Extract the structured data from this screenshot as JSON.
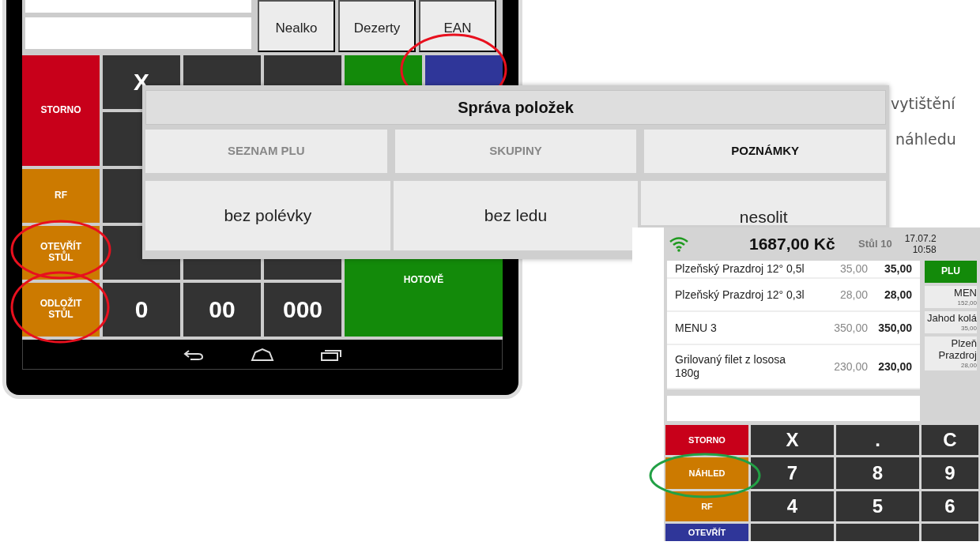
{
  "document_text": [
    "vytištění",
    "náhledu"
  ],
  "tablet": {
    "category_buttons": [
      "Nealko",
      "Dezerty",
      "EAN"
    ],
    "keys": [
      {
        "label": "STORNO",
        "color": "#c8001a"
      },
      {
        "label": "X",
        "color": "#333333"
      },
      {
        "color": "#333333"
      },
      {
        "color": "#333333"
      },
      {
        "color": "#138a0a"
      },
      {
        "color": "#2f3699"
      },
      {
        "color": "#333333"
      },
      {
        "label": "RF",
        "color": "#cc7a00"
      },
      {
        "color": "#333333"
      },
      {
        "label": "OTEVŘÍT STŮL",
        "color": "#cc7a00"
      },
      {
        "color": "#333333"
      },
      {
        "color": "#333333"
      },
      {
        "color": "#333333"
      },
      {
        "label": "HOTOVĚ",
        "color": "#138a0a"
      },
      {
        "label": "ODLOŽIT STŮL",
        "color": "#cc7a00"
      },
      {
        "label": "0",
        "color": "#333333"
      },
      {
        "label": "00",
        "color": "#333333"
      },
      {
        "label": "000",
        "color": "#333333"
      }
    ],
    "highlights": [
      {
        "color": "#e8101e"
      },
      {
        "color": "#e8101e"
      },
      {
        "color": "#e8101e"
      }
    ]
  },
  "dialog": {
    "title": "Správa položek",
    "tabs": [
      {
        "label": "SEZNAM PLU",
        "selected": false
      },
      {
        "label": "SKUPINY",
        "selected": false
      },
      {
        "label": "POZNÁMKY",
        "selected": true
      }
    ],
    "notes": [
      "bez polévky",
      "bez ledu",
      "nesolit"
    ]
  },
  "pos": {
    "total": "1687,00 Kč",
    "table": "Stůl 10",
    "date": "17.07.2",
    "time": "10:58",
    "items": [
      {
        "name": "Plzeňský Prazdroj 12° 0,5l",
        "price": "35,00",
        "total": "35,00"
      },
      {
        "name": "Plzeňský Prazdroj 12° 0,3l",
        "price": "28,00",
        "total": "28,00"
      },
      {
        "name": "MENU 3",
        "price": "350,00",
        "total": "350,00"
      },
      {
        "name": "Grilovaný filet z lososa 180g",
        "price": "230,00",
        "total": "230,00"
      }
    ],
    "side": [
      {
        "kind": "action",
        "label": "PLU"
      },
      {
        "kind": "product",
        "label": "MEN",
        "price": "152,00"
      },
      {
        "kind": "product",
        "label": "Jahod kolá",
        "price": "35,00"
      },
      {
        "kind": "product",
        "label": "Plzeň Prazdroj",
        "price": "28,00"
      }
    ],
    "keys": [
      {
        "label": "STORNO",
        "color": "#c8001a"
      },
      {
        "label": "X",
        "color": "#333333"
      },
      {
        "label": ".",
        "color": "#333333"
      },
      {
        "label": "C",
        "color": "#333333"
      },
      {
        "label": "NÁHLED",
        "color": "#cc7a00"
      },
      {
        "label": "7",
        "color": "#333333"
      },
      {
        "label": "8",
        "color": "#333333"
      },
      {
        "label": "9",
        "color": "#333333"
      },
      {
        "label": "RF",
        "color": "#cc7a00"
      },
      {
        "label": "4",
        "color": "#333333"
      },
      {
        "label": "5",
        "color": "#333333"
      },
      {
        "label": "6",
        "color": "#333333"
      },
      {
        "label": "OTEVŘÍT",
        "color": "#2f3699"
      },
      {
        "color": "#333333"
      },
      {
        "color": "#333333"
      },
      {
        "color": "#333333"
      }
    ],
    "highlights": [
      {
        "color": "#22a045"
      }
    ]
  }
}
